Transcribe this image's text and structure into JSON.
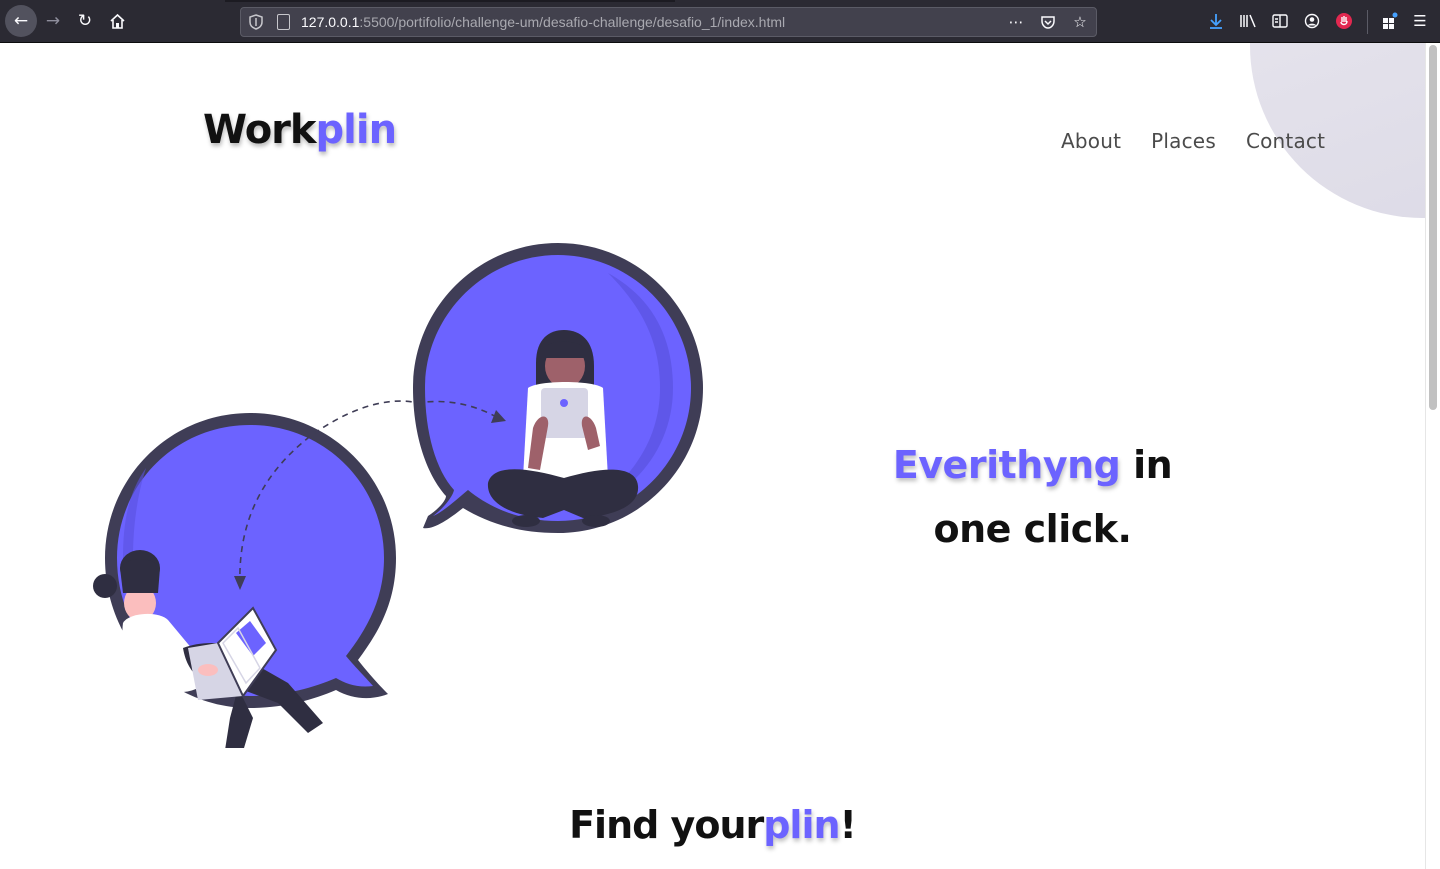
{
  "browser": {
    "url_host": "127.0.0.1",
    "url_rest": ":5500/portifolio/challenge-um/desafio-challenge/desafio_1/index.html",
    "icons": [
      "back-arrow-icon",
      "forward-arrow-icon",
      "reload-icon",
      "home-icon",
      "shield-icon",
      "page-icon",
      "more-icon",
      "pocket-icon",
      "star-icon",
      "download-icon",
      "library-icon",
      "reader-icon",
      "account-icon",
      "extension-icon",
      "puzzle-icon",
      "menu-icon"
    ]
  },
  "header": {
    "logo_main": "Work",
    "logo_accent": "plin",
    "nav": [
      "About",
      "Places",
      "Contact"
    ]
  },
  "hero": {
    "headline_accent": "Everithyng",
    "headline_rest_1": " in",
    "headline_line_2": "one click."
  },
  "section": {
    "find_main": "Find your",
    "find_accent": "plin",
    "find_end": "!"
  },
  "colors": {
    "accent": "#6c63ff",
    "bubble_dark": "#3f3d56",
    "text": "#111111",
    "nav_text": "#4b4b4b",
    "deco": "#e4e2ec"
  }
}
